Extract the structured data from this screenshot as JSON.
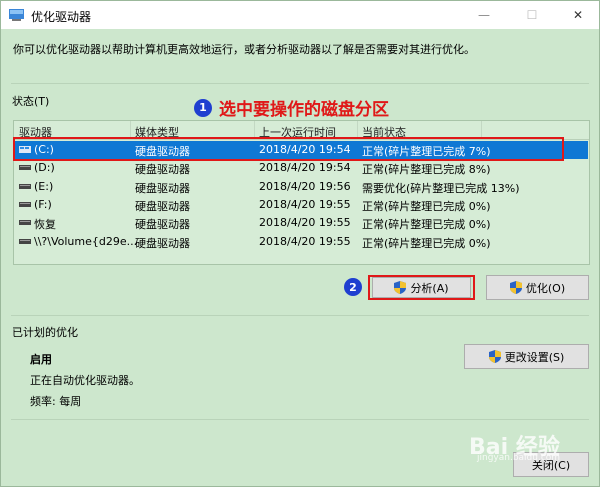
{
  "window": {
    "title": "优化驱动器",
    "minimize": "—",
    "maximize": "☐",
    "close": "✕"
  },
  "intro_text": "你可以优化驱动器以帮助计算机更高效地运行，或者分析驱动器以了解是否需要对其进行优化。",
  "status_label": "状态(T)",
  "annotation1": {
    "num": "1",
    "text": "选中要操作的磁盘分区"
  },
  "annotation2": {
    "num": "2"
  },
  "table": {
    "columns": [
      "驱动器",
      "媒体类型",
      "上一次运行时间",
      "当前状态"
    ],
    "rows": [
      {
        "drive": "(C:)",
        "media": "硬盘驱动器",
        "time": "2018/4/20 19:54",
        "status": "正常(碎片整理已完成 7%)",
        "selected": true
      },
      {
        "drive": "(D:)",
        "media": "硬盘驱动器",
        "time": "2018/4/20 19:54",
        "status": "正常(碎片整理已完成 8%)"
      },
      {
        "drive": "(E:)",
        "media": "硬盘驱动器",
        "time": "2018/4/20 19:56",
        "status": "需要优化(碎片整理已完成 13%)"
      },
      {
        "drive": "(F:)",
        "media": "硬盘驱动器",
        "time": "2018/4/20 19:55",
        "status": "正常(碎片整理已完成 0%)"
      },
      {
        "drive": "恢复",
        "media": "硬盘驱动器",
        "time": "2018/4/20 19:55",
        "status": "正常(碎片整理已完成 0%)"
      },
      {
        "drive": "\\\\?\\Volume{d29e...",
        "media": "硬盘驱动器",
        "time": "2018/4/20 19:55",
        "status": "正常(碎片整理已完成 0%)"
      }
    ]
  },
  "buttons": {
    "analyze": "分析(A)",
    "optimize": "优化(O)",
    "change_settings": "更改设置(S)",
    "close": "关闭(C)"
  },
  "scheduled": {
    "label": "已计划的优化",
    "state": "启用",
    "description": "正在自动优化驱动器。",
    "frequency": "频率: 每周"
  },
  "watermark": {
    "main": "Bai 经验",
    "sub": "jingyan.baidu.com"
  }
}
